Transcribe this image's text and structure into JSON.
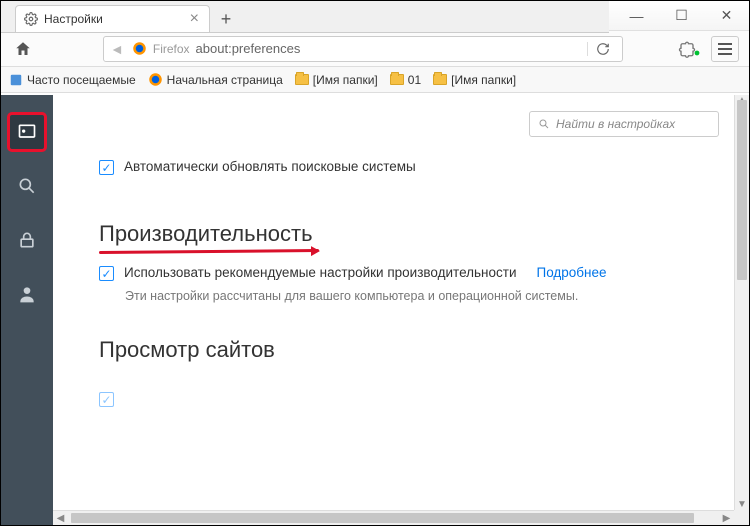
{
  "window": {
    "min": "—",
    "max": "☐",
    "close": "✕"
  },
  "tab": {
    "title": "Настройки"
  },
  "url": {
    "brand": "Firefox",
    "address": "about:preferences"
  },
  "bookmarks": {
    "frequent": "Часто посещаемые",
    "startpage": "Начальная страница",
    "folder1": "[Имя папки]",
    "folder2": "01",
    "folder3": "[Имя папки]"
  },
  "prefs": {
    "search_placeholder": "Найти в настройках",
    "auto_update_engines": "Автоматически обновлять поисковые системы",
    "perf_heading": "Производительность",
    "perf_use_recommended": "Использовать рекомендуемые настройки производительности",
    "perf_more": "Подробнее",
    "perf_hint": "Эти настройки рассчитаны для вашего компьютера и операционной системы.",
    "browsing_heading": "Просмотр сайтов"
  }
}
